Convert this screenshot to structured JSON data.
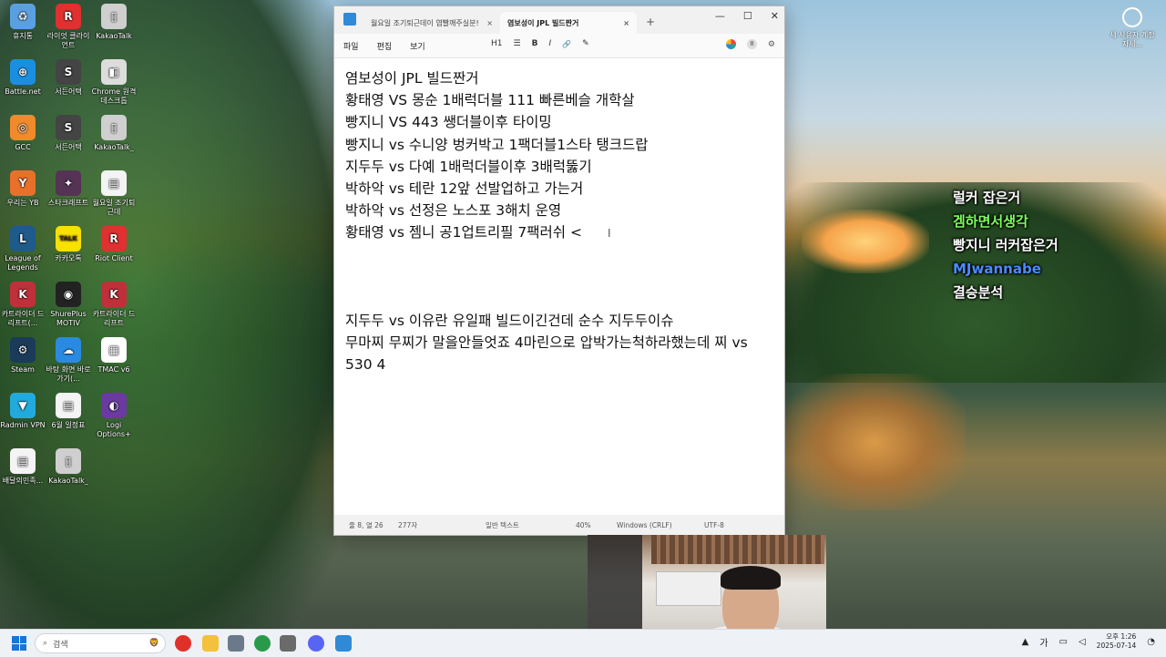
{
  "desktop_icons": [
    {
      "label": "휴지통",
      "color": "#5aa0e0",
      "glyph": "♻"
    },
    {
      "label": "라이엇 클라이언트",
      "color": "#e03030",
      "glyph": "R"
    },
    {
      "label": "KakaoTalk",
      "color": "#cfcfcf",
      "glyph": "▯"
    },
    {
      "label": "Battle.net",
      "color": "#1a8fe0",
      "glyph": "⊕"
    },
    {
      "label": "서든어택",
      "color": "#444444",
      "glyph": "S"
    },
    {
      "label": "Chrome 원격 데스크톱",
      "color": "#dddddd",
      "glyph": "◧"
    },
    {
      "label": "GCC",
      "color": "#f08a2a",
      "glyph": "◎"
    },
    {
      "label": "서든어택",
      "color": "#444444",
      "glyph": "S"
    },
    {
      "label": "KakaoTalk_",
      "color": "#cfcfcf",
      "glyph": "▯"
    },
    {
      "label": "우리는 YB",
      "color": "#e8702a",
      "glyph": "Y"
    },
    {
      "label": "스타크래프트",
      "color": "#553355",
      "glyph": "✦"
    },
    {
      "label": "월요일 조기퇴근데",
      "color": "#f4f4f4",
      "glyph": "▤"
    },
    {
      "label": "League of Legends",
      "color": "#1e5a8a",
      "glyph": "L"
    },
    {
      "label": "카카오톡",
      "color": "#f9e000",
      "glyph": "TALK"
    },
    {
      "label": "Riot Client",
      "color": "#e03030",
      "glyph": "R"
    },
    {
      "label": "카트라이더 드리프트(...",
      "color": "#c0303a",
      "glyph": "K"
    },
    {
      "label": "ShurePlus MOTIV",
      "color": "#222222",
      "glyph": "◉"
    },
    {
      "label": "카트라이더 드리프트",
      "color": "#c0303a",
      "glyph": "K"
    },
    {
      "label": "Steam",
      "color": "#1b3b5a",
      "glyph": "⚙"
    },
    {
      "label": "바탕 화면 바로 가기(...",
      "color": "#2a8ae0",
      "glyph": "☁"
    },
    {
      "label": "TMAC v6",
      "color": "#ffffff",
      "glyph": "▦"
    },
    {
      "label": "Radmin VPN",
      "color": "#22aadd",
      "glyph": "▼"
    },
    {
      "label": "6월 일정표",
      "color": "#f4f4f4",
      "glyph": "▤"
    },
    {
      "label": "Logi Options+",
      "color": "#6a3aa0",
      "glyph": "◐"
    },
    {
      "label": "배달의민족...",
      "color": "#f4f4f4",
      "glyph": "▤"
    },
    {
      "label": "KakaoTalk_",
      "color": "#cfcfcf",
      "glyph": "▯"
    }
  ],
  "notepad": {
    "tabs": [
      {
        "label": "월요일 조기퇴근데이 염빨깨주실분!",
        "active": false
      },
      {
        "label": "염보성이 JPL 빌드짠거",
        "active": true
      }
    ],
    "tab_close": "×",
    "tab_add": "+",
    "controls": {
      "minimize": "—",
      "maximize": "☐",
      "close": "✕"
    },
    "menu": {
      "file": "파일",
      "edit": "편집",
      "view": "보기"
    },
    "format": {
      "heading": "H1",
      "list": "☰",
      "bold": "B",
      "italic": "I",
      "link": "🔗",
      "clear": "✎"
    },
    "account_badge": "8",
    "lines": [
      "염보성이 JPL 빌드짠거",
      "황태영 VS 몽순 1배럭더블 111 빠른베슬 개학살",
      "빵지니 VS 443 쌩더블이후 타이밍",
      "빵지니 vs 수니양  벙커박고 1팩더블1스타 탱크드랍",
      "지두두 vs 다예  1배럭더블이후 3배럭뚫기",
      "박하악 vs 테란 12앞 선발업하고 가는거",
      "박하악 vs 선정은 노스포 3해치 운영",
      "황태영 vs 젬니  공1업트리필 7팩러쉬 <",
      "",
      "",
      "",
      "지두두 vs 이유란 유일패 빌드이긴건데 순수 지두두이슈",
      "무마찌 무찌가 말을안들엇죠 4마린으로 압박가는척하라했는데 찌 vs 530 4"
    ],
    "cursor_glyph": "I",
    "status": {
      "position": "줄 8, 열 26",
      "chars": "277자",
      "type": "일반 텍스트",
      "zoom": "40%",
      "line_ending": "Windows (CRLF)",
      "encoding": "UTF-8"
    }
  },
  "chat": [
    {
      "text": "럴커 잡은거",
      "color": "#ffffff"
    },
    {
      "text": "겜하면서생각",
      "color": "#7dff5a"
    },
    {
      "text": "빵지니 러커잡은거",
      "color": "#ffffff"
    },
    {
      "text": "MJwannabe",
      "color": "#4a8cff"
    },
    {
      "text": "결승분석",
      "color": "#ffffff"
    }
  ],
  "top_right_icon": {
    "label": "새 사용자 계정 자세..."
  },
  "taskbar": {
    "search_placeholder": "검색",
    "apps": [
      {
        "name": "youtube-music",
        "color": "#e0302a"
      },
      {
        "name": "file-explorer",
        "color": "#f3c23a"
      },
      {
        "name": "mail",
        "color": "#6a7a8a"
      },
      {
        "name": "chrome",
        "color": "#2a9a4a"
      },
      {
        "name": "settings",
        "color": "#6a6a6a"
      },
      {
        "name": "discord",
        "color": "#5865f2"
      },
      {
        "name": "notepad",
        "color": "#2f8ad8"
      }
    ],
    "tray": {
      "expand": "▲",
      "ime": "가",
      "clock_time": "오후 1:26",
      "clock_date": "2025-07-14"
    }
  }
}
